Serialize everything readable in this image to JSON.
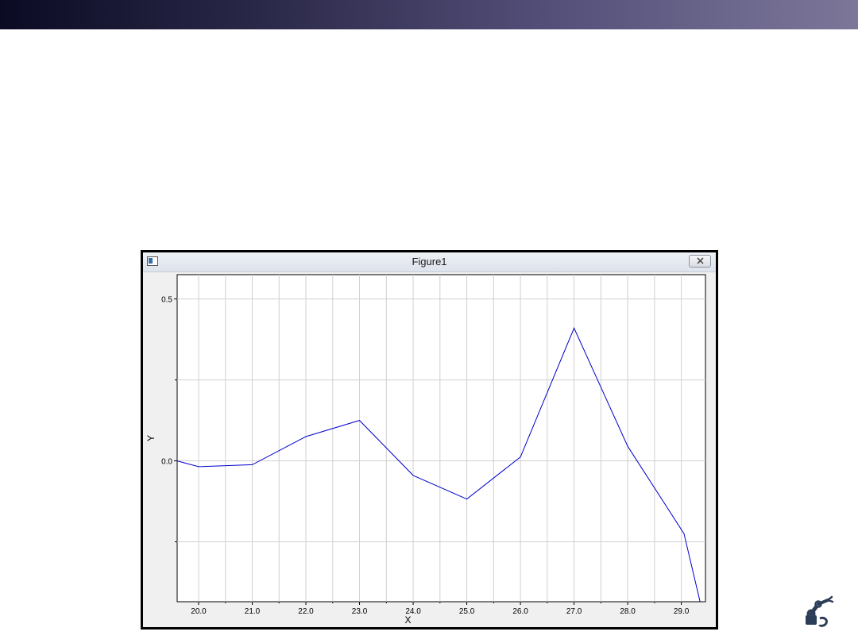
{
  "window": {
    "title": "Figure1"
  },
  "icons": {
    "window_icon": "figure-window-icon",
    "close_icon": "close-icon",
    "logo": "robot-arm-logo"
  },
  "colors": {
    "band_dark": "#0b0b24",
    "band_light": "#7c7799",
    "line": "#0000cc"
  },
  "chart_data": {
    "type": "line",
    "title": "",
    "xlabel": "X",
    "ylabel": "Y",
    "xlim": [
      19.6,
      29.45
    ],
    "ylim": [
      -0.435,
      0.575
    ],
    "grid": true,
    "x_ticks": [
      20.0,
      21.0,
      22.0,
      23.0,
      24.0,
      25.0,
      26.0,
      27.0,
      28.0,
      29.0
    ],
    "x_tick_labels": [
      "20.0",
      "21.0",
      "22.0",
      "23.0",
      "24.0",
      "25.0",
      "26.0",
      "27.0",
      "28.0",
      "29.0"
    ],
    "y_ticks": [
      0.5,
      0.0
    ],
    "y_tick_labels": [
      "0.5",
      "0.0"
    ],
    "y_minor_ticks": [
      0.25,
      -0.25
    ],
    "series": [
      {
        "x": [
          19.6,
          20.0,
          21.0,
          22.0,
          23.0,
          24.0,
          25.0,
          26.0,
          27.0,
          28.0,
          29.05,
          29.35
        ],
        "y": [
          0.0,
          -0.018,
          -0.012,
          0.075,
          0.125,
          -0.045,
          -0.118,
          0.012,
          0.41,
          0.045,
          -0.225,
          -0.435
        ]
      }
    ]
  }
}
